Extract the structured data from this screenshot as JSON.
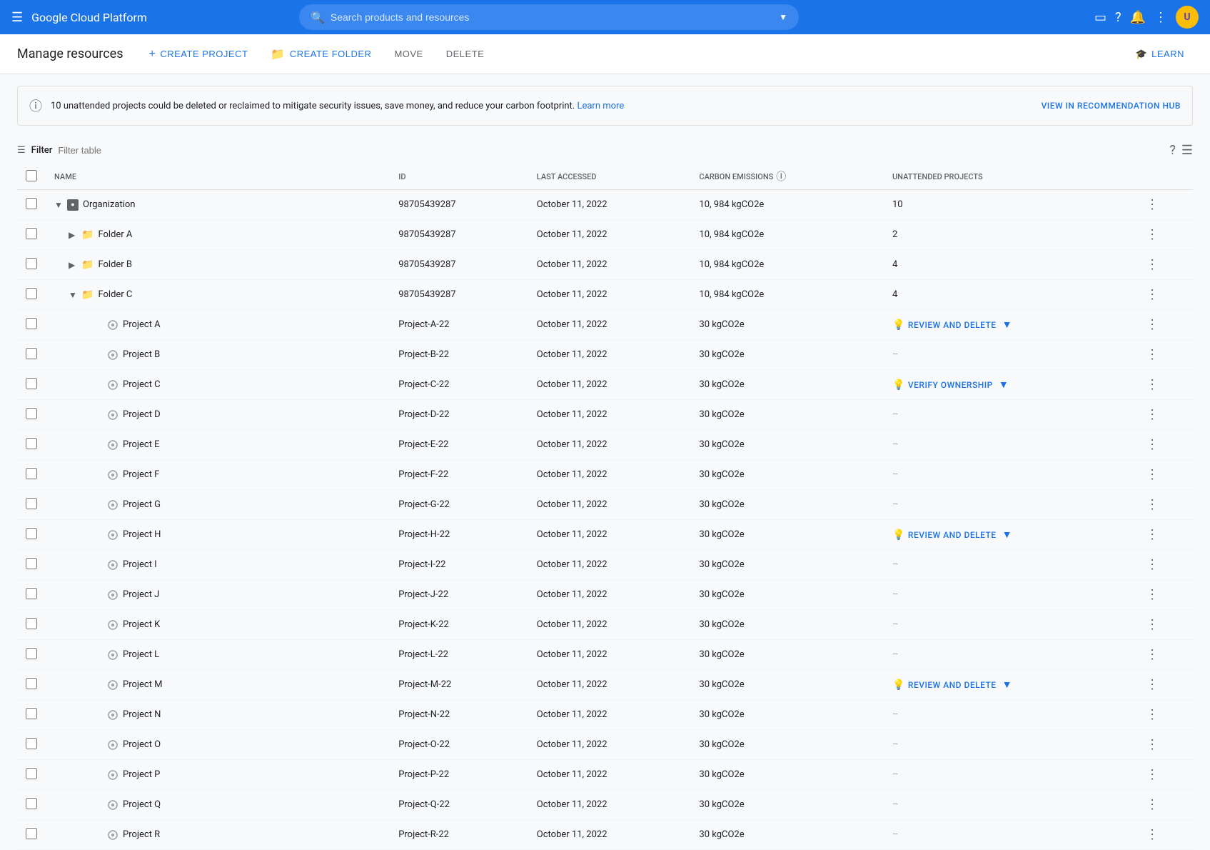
{
  "header": {
    "logo": "Google Cloud Platform",
    "search_placeholder": "Search products and resources"
  },
  "toolbar": {
    "page_title": "Manage resources",
    "create_project_label": "CREATE PROJECT",
    "create_folder_label": "CREATE FOLDER",
    "move_label": "MOVE",
    "delete_label": "DELETE",
    "learn_label": "LEARN"
  },
  "banner": {
    "text": "10 unattended projects could be deleted or reclaimed to mitigate security issues, save money, and reduce your carbon footprint.",
    "link_text": "Learn more",
    "action": "VIEW IN RECOMMENDATION HUB"
  },
  "filter": {
    "label": "Filter",
    "placeholder": "Filter table"
  },
  "table": {
    "columns": [
      "Name",
      "ID",
      "Last accessed",
      "Carbon emissions",
      "Unattended projects"
    ],
    "rows": [
      {
        "level": 0,
        "type": "org",
        "expand": "collapse",
        "name": "Organization",
        "id": "98705439287",
        "last_accessed": "October 11, 2022",
        "carbon": "10, 984 kgCO2e",
        "unattended": "10",
        "action": null
      },
      {
        "level": 1,
        "type": "folder",
        "expand": "expand",
        "name": "Folder A",
        "id": "98705439287",
        "last_accessed": "October 11, 2022",
        "carbon": "10, 984 kgCO2e",
        "unattended": "2",
        "action": null
      },
      {
        "level": 1,
        "type": "folder",
        "expand": "expand",
        "name": "Folder B",
        "id": "98705439287",
        "last_accessed": "October 11, 2022",
        "carbon": "10, 984 kgCO2e",
        "unattended": "4",
        "action": null
      },
      {
        "level": 1,
        "type": "folder",
        "expand": "collapse",
        "name": "Folder C",
        "id": "98705439287",
        "last_accessed": "October 11, 2022",
        "carbon": "10, 984 kgCO2e",
        "unattended": "4",
        "action": null
      },
      {
        "level": 2,
        "type": "project",
        "expand": null,
        "name": "Project A",
        "id": "Project-A-22",
        "last_accessed": "October 11, 2022",
        "carbon": "30 kgCO2e",
        "unattended": "action",
        "action": "REVIEW AND DELETE"
      },
      {
        "level": 2,
        "type": "project",
        "expand": null,
        "name": "Project B",
        "id": "Project-B-22",
        "last_accessed": "October 11, 2022",
        "carbon": "30 kgCO2e",
        "unattended": "dash",
        "action": null
      },
      {
        "level": 2,
        "type": "project",
        "expand": null,
        "name": "Project C",
        "id": "Project-C-22",
        "last_accessed": "October 11, 2022",
        "carbon": "30 kgCO2e",
        "unattended": "action",
        "action": "VERIFY OWNERSHIP"
      },
      {
        "level": 2,
        "type": "project",
        "expand": null,
        "name": "Project D",
        "id": "Project-D-22",
        "last_accessed": "October 11, 2022",
        "carbon": "30 kgCO2e",
        "unattended": "dash",
        "action": null
      },
      {
        "level": 2,
        "type": "project",
        "expand": null,
        "name": "Project E",
        "id": "Project-E-22",
        "last_accessed": "October 11, 2022",
        "carbon": "30 kgCO2e",
        "unattended": "dash",
        "action": null
      },
      {
        "level": 2,
        "type": "project",
        "expand": null,
        "name": "Project F",
        "id": "Project-F-22",
        "last_accessed": "October 11, 2022",
        "carbon": "30 kgCO2e",
        "unattended": "dash",
        "action": null
      },
      {
        "level": 2,
        "type": "project",
        "expand": null,
        "name": "Project G",
        "id": "Project-G-22",
        "last_accessed": "October 11, 2022",
        "carbon": "30 kgCO2e",
        "unattended": "dash",
        "action": null
      },
      {
        "level": 2,
        "type": "project",
        "expand": null,
        "name": "Project H",
        "id": "Project-H-22",
        "last_accessed": "October 11, 2022",
        "carbon": "30 kgCO2e",
        "unattended": "action",
        "action": "REVIEW AND DELETE"
      },
      {
        "level": 2,
        "type": "project",
        "expand": null,
        "name": "Project I",
        "id": "Project-I-22",
        "last_accessed": "October 11, 2022",
        "carbon": "30 kgCO2e",
        "unattended": "dash",
        "action": null
      },
      {
        "level": 2,
        "type": "project",
        "expand": null,
        "name": "Project J",
        "id": "Project-J-22",
        "last_accessed": "October 11, 2022",
        "carbon": "30 kgCO2e",
        "unattended": "dash",
        "action": null
      },
      {
        "level": 2,
        "type": "project",
        "expand": null,
        "name": "Project K",
        "id": "Project-K-22",
        "last_accessed": "October 11, 2022",
        "carbon": "30 kgCO2e",
        "unattended": "dash",
        "action": null
      },
      {
        "level": 2,
        "type": "project",
        "expand": null,
        "name": "Project L",
        "id": "Project-L-22",
        "last_accessed": "October 11, 2022",
        "carbon": "30 kgCO2e",
        "unattended": "dash",
        "action": null
      },
      {
        "level": 2,
        "type": "project",
        "expand": null,
        "name": "Project M",
        "id": "Project-M-22",
        "last_accessed": "October 11, 2022",
        "carbon": "30 kgCO2e",
        "unattended": "action",
        "action": "REVIEW AND DELETE"
      },
      {
        "level": 2,
        "type": "project",
        "expand": null,
        "name": "Project N",
        "id": "Project-N-22",
        "last_accessed": "October 11, 2022",
        "carbon": "30 kgCO2e",
        "unattended": "dash",
        "action": null
      },
      {
        "level": 2,
        "type": "project",
        "expand": null,
        "name": "Project O",
        "id": "Project-O-22",
        "last_accessed": "October 11, 2022",
        "carbon": "30 kgCO2e",
        "unattended": "dash",
        "action": null
      },
      {
        "level": 2,
        "type": "project",
        "expand": null,
        "name": "Project P",
        "id": "Project-P-22",
        "last_accessed": "October 11, 2022",
        "carbon": "30 kgCO2e",
        "unattended": "dash",
        "action": null
      },
      {
        "level": 2,
        "type": "project",
        "expand": null,
        "name": "Project Q",
        "id": "Project-Q-22",
        "last_accessed": "October 11, 2022",
        "carbon": "30 kgCO2e",
        "unattended": "dash",
        "action": null
      },
      {
        "level": 2,
        "type": "project",
        "expand": null,
        "name": "Project R",
        "id": "Project-R-22",
        "last_accessed": "October 11, 2022",
        "carbon": "30 kgCO2e",
        "unattended": "dash",
        "action": null
      }
    ]
  }
}
